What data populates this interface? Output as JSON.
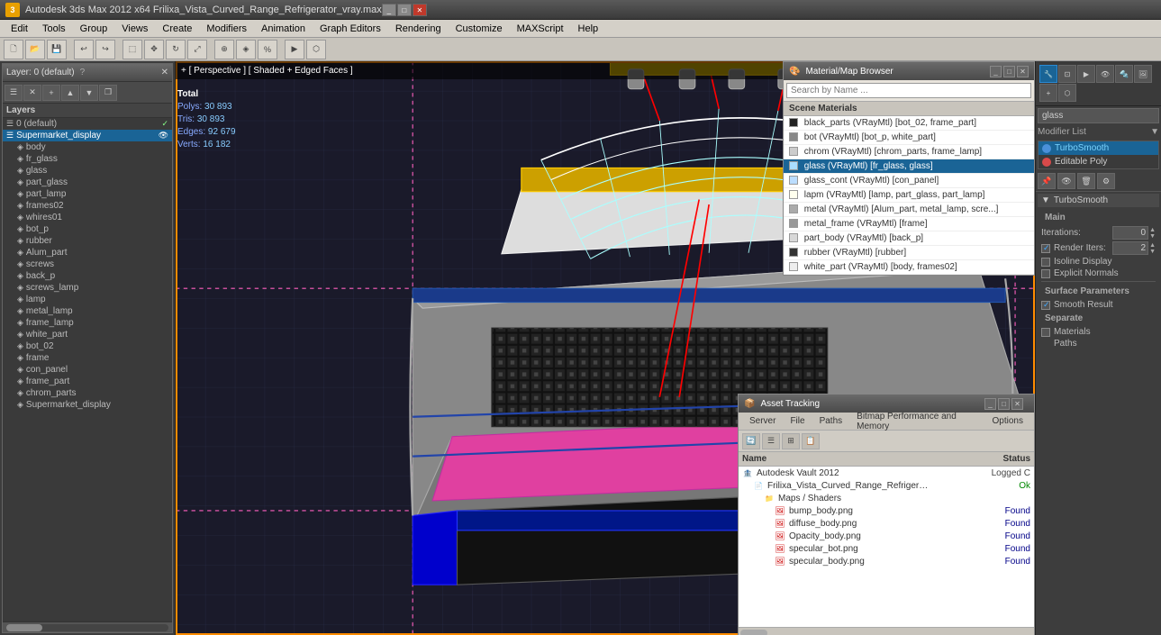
{
  "app": {
    "title": "Autodesk 3ds Max 2012 x64",
    "file": "Frilixa_Vista_Curved_Range_Refrigerator_vray.max",
    "full_title": "Autodesk 3ds Max 2012 x64      Frilixa_Vista_Curved_Range_Refrigerator_vray.max"
  },
  "menu": {
    "items": [
      "Edit",
      "Tools",
      "Group",
      "Views",
      "Create",
      "Modifiers",
      "Animation",
      "Graph Editors",
      "Rendering",
      "Customize",
      "MAXScript",
      "Help"
    ]
  },
  "viewport": {
    "label": "+ [ Perspective ] [ Shaded + Edged Faces ]",
    "stats": {
      "total_label": "Total",
      "polys_label": "Polys:",
      "polys_val": "30 893",
      "tris_label": "Tris:",
      "tris_val": "30 893",
      "edges_label": "Edges:",
      "edges_val": "92 679",
      "verts_label": "Verts:",
      "verts_val": "16 182"
    }
  },
  "layer_window": {
    "title": "Layer: 0 (default)",
    "help_btn": "?",
    "close_btn": "✕",
    "layers_label": "Layers",
    "toolbar_btns": [
      "☰",
      "✕",
      "+",
      "▲",
      "▼",
      "❐"
    ],
    "items": [
      {
        "name": "0 (default)",
        "indent": 0,
        "checked": true,
        "icon": "layer"
      },
      {
        "name": "Supermarket_display",
        "indent": 0,
        "icon": "layer",
        "selected": true
      },
      {
        "name": "body",
        "indent": 1,
        "icon": "obj"
      },
      {
        "name": "fr_glass",
        "indent": 1,
        "icon": "obj"
      },
      {
        "name": "glass",
        "indent": 1,
        "icon": "obj"
      },
      {
        "name": "part_glass",
        "indent": 1,
        "icon": "obj"
      },
      {
        "name": "part_lamp",
        "indent": 1,
        "icon": "obj"
      },
      {
        "name": "frames02",
        "indent": 1,
        "icon": "obj"
      },
      {
        "name": "whires01",
        "indent": 1,
        "icon": "obj"
      },
      {
        "name": "bot_p",
        "indent": 1,
        "icon": "obj"
      },
      {
        "name": "rubber",
        "indent": 1,
        "icon": "obj"
      },
      {
        "name": "Alum_part",
        "indent": 1,
        "icon": "obj"
      },
      {
        "name": "screws",
        "indent": 1,
        "icon": "obj"
      },
      {
        "name": "back_p",
        "indent": 1,
        "icon": "obj"
      },
      {
        "name": "screws_lamp",
        "indent": 1,
        "icon": "obj"
      },
      {
        "name": "lamp",
        "indent": 1,
        "icon": "obj"
      },
      {
        "name": "metal_lamp",
        "indent": 1,
        "icon": "obj"
      },
      {
        "name": "frame_lamp",
        "indent": 1,
        "icon": "obj"
      },
      {
        "name": "white_part",
        "indent": 1,
        "icon": "obj"
      },
      {
        "name": "bot_02",
        "indent": 1,
        "icon": "obj"
      },
      {
        "name": "frame",
        "indent": 1,
        "icon": "obj"
      },
      {
        "name": "con_panel",
        "indent": 1,
        "icon": "obj"
      },
      {
        "name": "frame_part",
        "indent": 1,
        "icon": "obj"
      },
      {
        "name": "chrom_parts",
        "indent": 1,
        "icon": "obj"
      },
      {
        "name": "Supermarket_display",
        "indent": 1,
        "icon": "obj"
      }
    ]
  },
  "mat_browser": {
    "title": "Material/Map Browser",
    "search_placeholder": "Search by Name ...",
    "section_title": "Scene Materials",
    "materials": [
      {
        "name": "black_parts (VRayMtl) [bot_02, frame_part]",
        "color": "#222"
      },
      {
        "name": "bot (VRayMtl) [bot_p, white_part]",
        "color": "#888"
      },
      {
        "name": "chrom (VRayMtl) [chrom_parts, frame_lamp]",
        "color": "#ccc"
      },
      {
        "name": "glass (VRayMtl) [fr_glass, glass]",
        "color": "#aaddff",
        "selected": true
      },
      {
        "name": "glass_cont (VRayMtl) [con_panel]",
        "color": "#bbddff"
      },
      {
        "name": "lapm (VRayMtl) [lamp, part_glass, part_lamp]",
        "color": "#ffe"
      },
      {
        "name": "metal (VRayMtl) [Alum_part, metal_lamp, scre...]",
        "color": "#aaa"
      },
      {
        "name": "metal_frame (VRayMtl) [frame]",
        "color": "#999"
      },
      {
        "name": "part_body (VRayMtl) [back_p]",
        "color": "#d8d8d8"
      },
      {
        "name": "rubber (VRayMtl) [rubber]",
        "color": "#333"
      },
      {
        "name": "white_part (VRayMtl) [body, frames02]",
        "color": "#eee"
      }
    ]
  },
  "modifier_panel": {
    "search_placeholder": "glass",
    "modifier_list_label": "Modifier List",
    "stack": [
      {
        "name": "TurboSmooth",
        "type": "turbosmooth",
        "selected": true
      },
      {
        "name": "Editable Poly",
        "type": "poly"
      }
    ],
    "turbosmooth": {
      "title": "TurboSmooth",
      "main_label": "Main",
      "iterations_label": "Iterations:",
      "iterations_val": "0",
      "render_iters_label": "Render Iters:",
      "render_iters_val": "2",
      "render_iters_checked": true,
      "isoline_label": "Isoline Display",
      "explicit_label": "Explicit Normals",
      "surface_label": "Surface Parameters",
      "smooth_label": "Smooth Result",
      "smooth_checked": true,
      "separate_label": "Separate",
      "materials_label": "Materials",
      "paths_label": "Paths"
    }
  },
  "asset_tracking": {
    "title": "Asset Tracking",
    "menu_items": [
      "Server",
      "File",
      "Paths",
      "Bitmap Performance and Memory",
      "Options"
    ],
    "name_col": "Name",
    "status_col": "Status",
    "items": [
      {
        "name": "Autodesk Vault 2012",
        "indent": 0,
        "icon": "vault",
        "status": "Logged C",
        "level": 0
      },
      {
        "name": "Frilixa_Vista_Curved_Range_Refrigerator_vray.max",
        "indent": 1,
        "icon": "file",
        "status": "Ok",
        "level": 1
      },
      {
        "name": "Maps / Shaders",
        "indent": 2,
        "icon": "folder",
        "status": "",
        "level": 2
      },
      {
        "name": "bump_body.png",
        "indent": 3,
        "icon": "img",
        "status": "Found",
        "level": 3
      },
      {
        "name": "diffuse_body.png",
        "indent": 3,
        "icon": "img",
        "status": "Found",
        "level": 3
      },
      {
        "name": "Opacity_body.png",
        "indent": 3,
        "icon": "img",
        "status": "Found",
        "level": 3
      },
      {
        "name": "specular_bot.png",
        "indent": 3,
        "icon": "img",
        "status": "Found",
        "level": 3
      },
      {
        "name": "specular_body.png",
        "indent": 3,
        "icon": "img",
        "status": "Found",
        "level": 3
      }
    ]
  },
  "colors": {
    "selected_blue": "#1a6496",
    "turbosmooth_blue": "#7ad4ff",
    "accent_orange": "#ff8c00",
    "found_green": "#006600",
    "ok_green": "#006600",
    "magenta_floor": "#e040a0"
  }
}
